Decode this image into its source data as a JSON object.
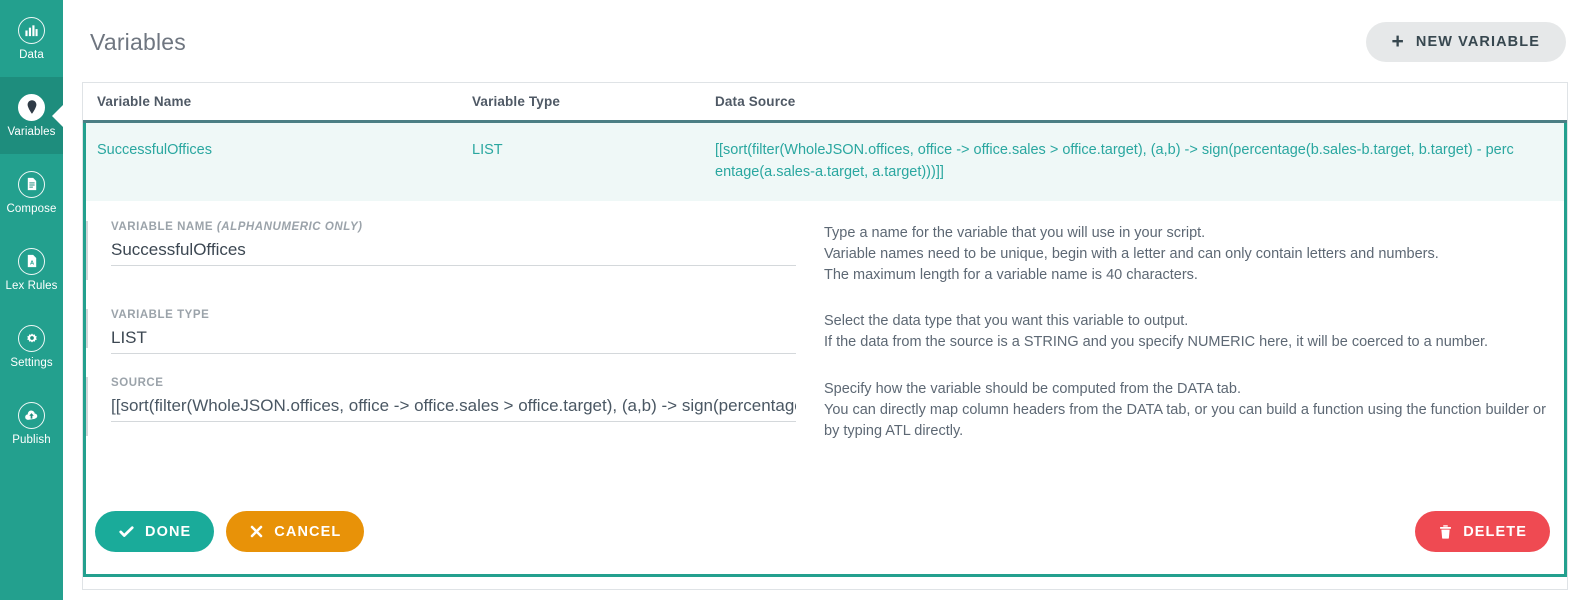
{
  "sidebar": {
    "items": [
      {
        "label": "Data",
        "icon": "chart-bar-icon",
        "active": false
      },
      {
        "label": "Variables",
        "icon": "map-pin-icon",
        "active": true
      },
      {
        "label": "Compose",
        "icon": "document-icon",
        "active": false
      },
      {
        "label": "Lex Rules",
        "icon": "document-abc-icon",
        "active": false
      },
      {
        "label": "Settings",
        "icon": "gear-icon",
        "active": false
      },
      {
        "label": "Publish",
        "icon": "cloud-upload-icon",
        "active": false
      }
    ]
  },
  "header": {
    "title": "Variables",
    "new_variable_label": "NEW VARIABLE",
    "new_variable_icon": "plus-icon"
  },
  "table": {
    "columns": [
      "Variable Name",
      "Variable Type",
      "Data Source"
    ],
    "rows": [
      {
        "name": "SuccessfulOffices",
        "type": "LIST",
        "source": "[[sort(filter(WholeJSON.offices, office -> office.sales > office.target), (a,b) -> sign(percentage(b.sales-b.target, b.target) - percentage(a.sales-a.target, a.target)))]]"
      }
    ]
  },
  "editor": {
    "fields": [
      {
        "label": "VARIABLE NAME ",
        "label_italic": "(ALPHANUMERIC ONLY)",
        "value": "SuccessfulOffices",
        "placeholder": "Variable name",
        "help": [
          "Type a name for the variable that you will use in your script.",
          "Variable names need to be unique, begin with a letter and can only contain letters and numbers.",
          "The maximum length for a variable name is 40 characters."
        ]
      },
      {
        "label": "VARIABLE TYPE",
        "label_italic": "",
        "value": "LIST",
        "placeholder": "Variable type",
        "help": [
          "Select the data type that you want this variable to output.",
          "If the data from the source is a STRING and you specify NUMERIC here, it will be coerced to a number."
        ]
      },
      {
        "label": "SOURCE",
        "label_italic": "",
        "value": "[[sort(filter(WholeJSON.offices, office -> office.sales > office.target), (a,b) -> sign(percentage(b.sales-b.target, b.target) - percentage(a.sales-a.target, a.target)))]]",
        "placeholder": "Source",
        "help": [
          "Specify how the variable should be computed from the DATA tab.",
          "You can directly map column headers from the DATA tab, or you can build a function using the function builder or",
          "by typing ATL directly."
        ]
      }
    ],
    "buttons": {
      "done": {
        "label": "DONE",
        "icon": "check-icon",
        "color": "#1aab9a"
      },
      "cancel": {
        "label": "CANCEL",
        "icon": "close-icon",
        "color": "#e89208"
      },
      "delete": {
        "label": "DELETE",
        "icon": "trash-icon",
        "color": "#ef4a52"
      }
    }
  },
  "colors": {
    "brand_teal": "#23a08e",
    "sidebar_active": "#1e8d7d",
    "row_highlight": "#eff8f7",
    "link_teal": "#2aa7a0",
    "header_rule": "#4b7e84"
  }
}
